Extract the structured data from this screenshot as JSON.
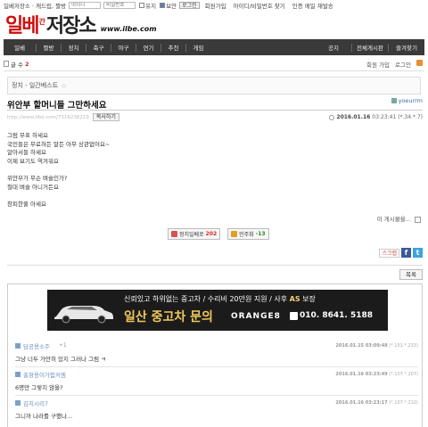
{
  "topbar": {
    "site_links": "일베저장소 · 캐드립, 짤방",
    "id_placeholder": "아이디",
    "pw_placeholder": "비밀번호",
    "keep_label": "유지",
    "secure_label": "보안",
    "login_button": "로그인",
    "signup": "회원가입",
    "find": "아이디/비밀번호 찾기",
    "resend": "인증 메일 재발송"
  },
  "logo": {
    "part1": "일베",
    "part2": "간",
    "part3": "저장소",
    "url": "www.ilbe.com"
  },
  "nav": {
    "items": [
      "일베",
      "짤방",
      "정치",
      "축구",
      "야구",
      "연기",
      "추천",
      "게임"
    ],
    "right_items": [
      "공지",
      "전체게시판",
      "즐겨찾기"
    ]
  },
  "subbar": {
    "count_label": "글 수",
    "count": "2",
    "signup": "회원 가입",
    "login": "로그인"
  },
  "board": {
    "path": "정치 - 일간베스트",
    "star": "☆"
  },
  "post": {
    "title": "위안부 할머니들 그만하세요",
    "author": "yoeurrm",
    "url": "http://www.ilbe.com/7316236219",
    "copy_button": "복사하기",
    "date": "2016.01.16",
    "time": "03:23:41 (*.34.*.7)",
    "body_lines": [
      "그럼 무표 하세요",
      "국민들은 무료하든 말든 아무 상관없어요~",
      "알아서들 하세요",
      "이제 보기도 역겨워요",
      "",
      "위안부가 무슨 벼슬인가?",
      "절대 벼슬 아니거든요",
      "",
      "창피한줄 아세요"
    ],
    "more": "이 게시물을...",
    "upvote_label": "정치일베로",
    "upvote_count": "202",
    "downvote_label": "민주화",
    "downvote_count": "-13",
    "scrap": "스크랩",
    "list_button": "목록"
  },
  "ad": {
    "line1_a": "신뢰있고 하위없는 중고차 / 수리비 20만원 지원 / 사후",
    "line1_b": "AS",
    "line1_c": "보장",
    "line2": "일산 중고차 문의",
    "brand": "ORANGE8",
    "phone": "010. 8641. 5188"
  },
  "comments": [
    {
      "nick": "담공용소주",
      "plus": "+1",
      "meta": "2016.01.15 03:09:48",
      "ip": "(*.101.*.233)",
      "text": "그냥 너두 가만히 있지 그러나 그럼 ㅋ"
    },
    {
      "nick": "출항용이가험커엠",
      "plus": "",
      "meta": "2016.01.16 03:23:49",
      "ip": "(*.107.*.207)",
      "text": "6명만 그렇지 않을?"
    },
    {
      "nick": "김치시리7",
      "plus": "",
      "meta": "2016.01.16 03:23:17",
      "ip": "(*.107.*.210)",
      "text": "그니까 나라를 구했나..."
    }
  ]
}
